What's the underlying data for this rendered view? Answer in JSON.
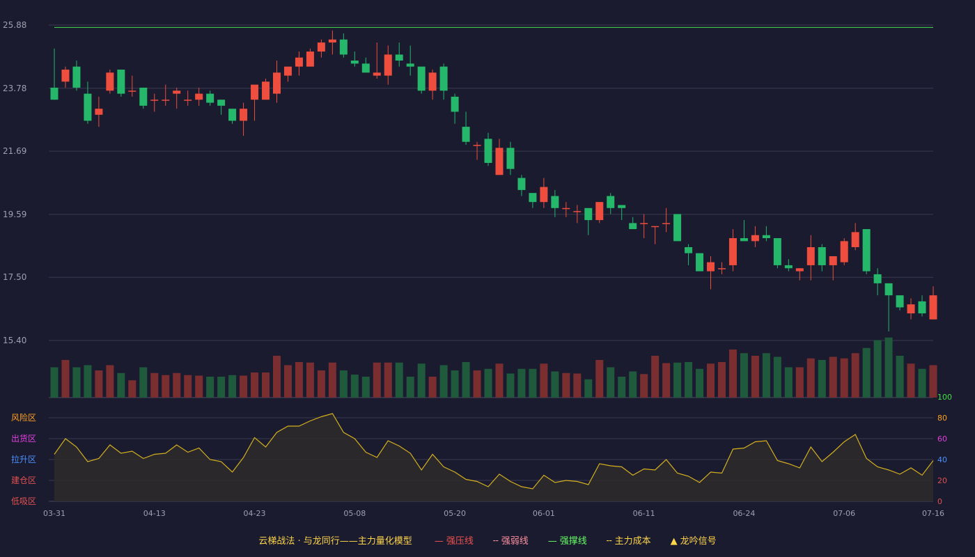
{
  "chart_data": [
    {
      "type": "candlestick",
      "price_ticks": [
        "25.88",
        "23.78",
        "21.69",
        "19.59",
        "17.50",
        "15.40"
      ],
      "ylim": [
        15.4,
        25.88
      ],
      "resistance_line": 25.8,
      "dates": [
        "03-31",
        "04-13",
        "04-23",
        "05-08",
        "05-20",
        "06-01",
        "06-11",
        "06-24",
        "07-06",
        "07-16"
      ],
      "candles": [
        [
          23.8,
          23.4,
          25.1,
          23.4
        ],
        [
          24.0,
          24.4,
          24.5,
          23.8
        ],
        [
          24.5,
          23.8,
          24.7,
          23.7
        ],
        [
          23.6,
          22.7,
          24.0,
          22.6
        ],
        [
          22.9,
          23.1,
          23.5,
          22.5
        ],
        [
          23.7,
          24.3,
          24.4,
          23.6
        ],
        [
          24.4,
          23.6,
          24.4,
          23.5
        ],
        [
          23.7,
          23.7,
          24.2,
          23.5
        ],
        [
          23.8,
          23.2,
          23.8,
          23.1
        ],
        [
          23.4,
          23.4,
          23.6,
          23.0
        ],
        [
          23.4,
          23.4,
          23.9,
          23.2
        ],
        [
          23.6,
          23.7,
          23.8,
          23.1
        ],
        [
          23.4,
          23.4,
          23.7,
          23.2
        ],
        [
          23.4,
          23.6,
          23.8,
          23.2
        ],
        [
          23.6,
          23.3,
          23.7,
          23.2
        ],
        [
          23.4,
          23.2,
          23.4,
          22.9
        ],
        [
          23.1,
          22.7,
          23.1,
          22.6
        ],
        [
          22.7,
          23.1,
          23.3,
          22.2
        ],
        [
          23.4,
          23.9,
          23.9,
          22.7
        ],
        [
          23.4,
          24.0,
          24.1,
          23.4
        ],
        [
          23.6,
          24.3,
          24.7,
          23.3
        ],
        [
          24.2,
          24.5,
          24.5,
          24.0
        ],
        [
          24.5,
          24.8,
          25.0,
          24.2
        ],
        [
          24.5,
          25.0,
          25.1,
          24.5
        ],
        [
          25.0,
          25.3,
          25.4,
          24.8
        ],
        [
          25.3,
          25.4,
          25.7,
          24.9
        ],
        [
          25.4,
          24.9,
          25.6,
          24.8
        ],
        [
          24.7,
          24.6,
          25.0,
          24.5
        ],
        [
          24.6,
          24.3,
          24.8,
          24.3
        ],
        [
          24.2,
          24.3,
          25.3,
          24.1
        ],
        [
          24.2,
          24.9,
          25.2,
          23.9
        ],
        [
          24.9,
          24.7,
          25.3,
          24.5
        ],
        [
          24.6,
          24.5,
          25.2,
          24.2
        ],
        [
          24.5,
          23.7,
          24.5,
          23.6
        ],
        [
          23.7,
          24.3,
          24.4,
          23.4
        ],
        [
          24.5,
          23.7,
          24.6,
          23.4
        ],
        [
          23.5,
          23.0,
          23.6,
          22.6
        ],
        [
          22.5,
          22.0,
          23.0,
          21.9
        ],
        [
          21.9,
          21.9,
          22.0,
          21.4
        ],
        [
          22.1,
          21.3,
          22.3,
          21.2
        ],
        [
          20.9,
          21.8,
          22.1,
          20.9
        ],
        [
          21.8,
          21.1,
          22.0,
          20.9
        ],
        [
          20.8,
          20.4,
          20.9,
          20.2
        ],
        [
          20.3,
          20.0,
          20.3,
          19.8
        ],
        [
          20.0,
          20.5,
          20.8,
          19.8
        ],
        [
          20.2,
          19.8,
          20.4,
          19.5
        ],
        [
          19.8,
          19.8,
          20.0,
          19.5
        ],
        [
          19.7,
          19.7,
          19.9,
          19.3
        ],
        [
          19.8,
          19.4,
          19.8,
          18.9
        ],
        [
          19.4,
          20.0,
          20.0,
          19.3
        ],
        [
          20.2,
          19.8,
          20.3,
          19.6
        ],
        [
          19.9,
          19.8,
          19.9,
          19.4
        ],
        [
          19.3,
          19.1,
          19.5,
          19.1
        ],
        [
          19.3,
          19.3,
          19.6,
          18.8
        ],
        [
          19.2,
          19.2,
          19.2,
          18.6
        ],
        [
          19.3,
          19.3,
          19.8,
          19.0
        ],
        [
          19.6,
          18.7,
          19.6,
          18.7
        ],
        [
          18.5,
          18.3,
          18.6,
          17.9
        ],
        [
          18.3,
          17.7,
          18.3,
          17.7
        ],
        [
          17.7,
          18.0,
          18.2,
          17.1
        ],
        [
          17.8,
          17.8,
          18.0,
          17.6
        ],
        [
          17.9,
          18.8,
          19.1,
          17.7
        ],
        [
          18.8,
          18.7,
          19.4,
          18.7
        ],
        [
          18.7,
          18.9,
          19.2,
          18.5
        ],
        [
          18.9,
          18.8,
          19.2,
          18.7
        ],
        [
          18.8,
          17.9,
          18.8,
          17.8
        ],
        [
          17.9,
          17.8,
          18.1,
          17.7
        ],
        [
          17.7,
          17.8,
          17.8,
          17.4
        ],
        [
          17.9,
          18.5,
          18.9,
          17.4
        ],
        [
          18.5,
          17.9,
          18.6,
          17.7
        ],
        [
          17.9,
          18.2,
          18.2,
          17.4
        ],
        [
          18.0,
          18.7,
          18.8,
          17.9
        ],
        [
          18.5,
          19.0,
          19.3,
          18.4
        ],
        [
          19.1,
          17.7,
          19.1,
          17.6
        ],
        [
          17.6,
          17.3,
          17.8,
          16.9
        ],
        [
          17.3,
          16.9,
          17.3,
          15.7
        ],
        [
          16.9,
          16.5,
          16.9,
          16.4
        ],
        [
          16.3,
          16.6,
          16.8,
          16.1
        ],
        [
          16.7,
          16.3,
          16.9,
          16.2
        ],
        [
          16.1,
          16.9,
          17.2,
          16.1
        ]
      ],
      "volumes": [
        58,
        72,
        58,
        62,
        52,
        62,
        47,
        33,
        58,
        47,
        43,
        47,
        43,
        42,
        40,
        40,
        43,
        42,
        48,
        48,
        80,
        62,
        68,
        67,
        52,
        67,
        52,
        44,
        40,
        67,
        67,
        67,
        40,
        65,
        40,
        62,
        52,
        68,
        52,
        55,
        65,
        46,
        55,
        55,
        65,
        50,
        47,
        46,
        35,
        72,
        58,
        40,
        50,
        45,
        80,
        66,
        67,
        68,
        55,
        65,
        68,
        92,
        85,
        80,
        85,
        78,
        58,
        58,
        75,
        72,
        78,
        75,
        85,
        95,
        110,
        115,
        80,
        65,
        55,
        62
      ],
      "oscillator_ticks": [
        "0",
        "20",
        "40",
        "60",
        "80",
        "100"
      ],
      "oscillator_zones": [
        "风险区",
        "出货区",
        "拉升区",
        "建仓区",
        "低吸区"
      ],
      "oscillator": [
        45,
        60,
        52,
        38,
        41,
        54,
        46,
        48,
        41,
        45,
        46,
        54,
        47,
        51,
        40,
        38,
        28,
        42,
        61,
        52,
        66,
        72,
        72,
        77,
        81,
        84,
        66,
        60,
        47,
        42,
        58,
        53,
        46,
        30,
        45,
        33,
        28,
        21,
        19,
        14,
        26,
        19,
        14,
        12,
        25,
        18,
        20,
        19,
        16,
        36,
        34,
        33,
        25,
        31,
        30,
        40,
        27,
        24,
        18,
        28,
        27,
        50,
        51,
        57,
        58,
        39,
        36,
        32,
        52,
        38,
        47,
        57,
        64,
        41,
        33,
        30,
        26,
        32,
        25,
        39
      ]
    }
  ],
  "legend": {
    "title": "云梯战法 · 与龙同行——主力量化模型",
    "items": [
      {
        "label": "强压线",
        "symbol": "—",
        "color": "#ef5350"
      },
      {
        "label": "强弱线",
        "symbol": "╌",
        "color": "#ff8fa0"
      },
      {
        "label": "强撑线",
        "symbol": "—",
        "color": "#66ff66"
      },
      {
        "label": "主力成本",
        "symbol": "╌",
        "color": "#ffd54a"
      },
      {
        "label": "龙吟信号",
        "symbol": "▲",
        "color": "#ffd54a"
      }
    ]
  },
  "colors": {
    "up": "#ef4d3e",
    "down": "#25b86b",
    "vol_up": "#7a2e30",
    "vol_down": "#1f5a3d",
    "grid": "#3a3b50",
    "axis_text": "#9ea0b0",
    "resistance": "#3ec84e",
    "osc_line": "#d4b020",
    "osc_fill": "#2c2a2a"
  }
}
